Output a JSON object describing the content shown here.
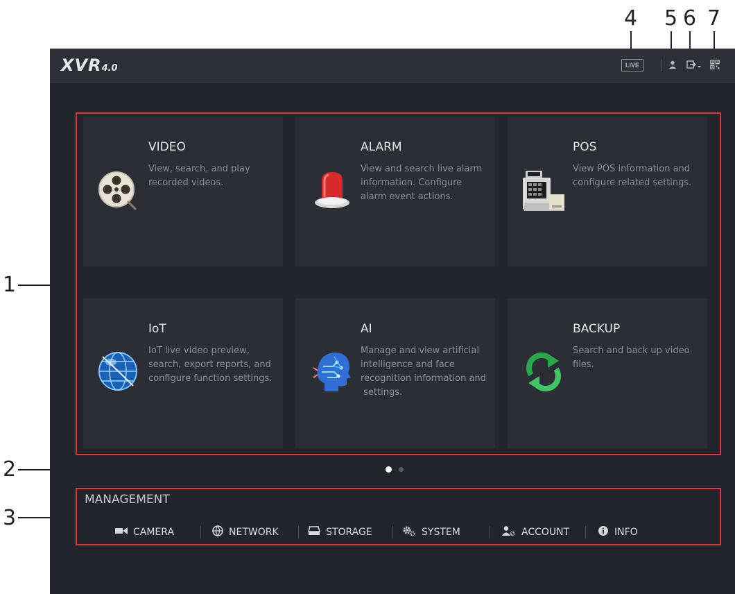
{
  "callouts": [
    "1",
    "2",
    "3",
    "4",
    "5",
    "6",
    "7"
  ],
  "header": {
    "logo_main": "XVR",
    "logo_version": "4.0",
    "live_label": "LIVE"
  },
  "tiles": [
    {
      "title": "VIDEO",
      "desc": [
        "View, search, and play",
        "recorded videos."
      ],
      "icon": "film-reel-icon"
    },
    {
      "title": "ALARM",
      "desc": [
        "View and search live alarm",
        "information. Configure",
        "alarm event actions."
      ],
      "icon": "alarm-siren-icon"
    },
    {
      "title": "POS",
      "desc": [
        "View POS information and",
        "configure related settings."
      ],
      "icon": "cash-register-icon"
    },
    {
      "title": "IoT",
      "desc": [
        "IoT live video preview,",
        "search, export reports, and",
        "configure function settings."
      ],
      "icon": "globe-icon"
    },
    {
      "title": "AI",
      "desc": [
        "Manage and view artificial",
        "intelligence and face",
        "recognition information and",
        " settings."
      ],
      "icon": "ai-head-icon"
    },
    {
      "title": "BACKUP",
      "desc": [
        "Search and back up video",
        "files."
      ],
      "icon": "backup-sync-icon"
    }
  ],
  "pagination": {
    "count": 2,
    "current": 1
  },
  "management": {
    "title": "MANAGEMENT",
    "items": [
      {
        "label": "CAMERA",
        "icon": "camera-icon"
      },
      {
        "label": "NETWORK",
        "icon": "network-icon"
      },
      {
        "label": "STORAGE",
        "icon": "storage-icon"
      },
      {
        "label": "SYSTEM",
        "icon": "gears-icon"
      },
      {
        "label": "ACCOUNT",
        "icon": "account-icon"
      },
      {
        "label": "INFO",
        "icon": "info-icon"
      }
    ]
  },
  "colors": {
    "accent_red": "#d63a3a",
    "background": "#22252b",
    "card": "#2b2e35"
  }
}
